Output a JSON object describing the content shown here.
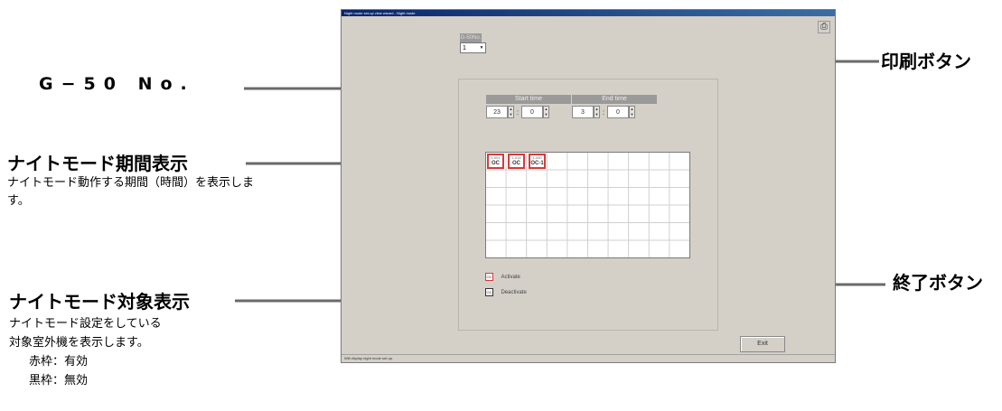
{
  "window": {
    "title": "Night mode set-up view wizard - Night mode",
    "status": "Will display night mode set-up."
  },
  "g50": {
    "label": "G-50No.",
    "value": "1"
  },
  "time": {
    "start_label": "Start time",
    "start_hour": "23",
    "start_min": "0",
    "end_label": "End time",
    "end_hour": "3",
    "end_min": "0",
    "colon": ":"
  },
  "grid": {
    "units": [
      {
        "num": "1-001",
        "code": "OC"
      },
      {
        "num": "1-015",
        "code": "OC"
      },
      {
        "num": "1-030",
        "code": "OC-1"
      }
    ]
  },
  "legend": {
    "icon_text": "OC",
    "activate": "Activate",
    "deactivate": "Deactivate"
  },
  "buttons": {
    "exit": "Exit",
    "print_icon": "printer-icon"
  },
  "annotations": {
    "g50": "G−50 No.",
    "night_period_title": "ナイトモード期間表示",
    "night_period_desc": "ナイトモード動作する期間（時間）を表示します。",
    "target_title": "ナイトモード対象表示",
    "target_desc_1": "ナイトモード設定をしている",
    "target_desc_2": "対象室外機を表示します。",
    "red_frame": "赤枠：有効",
    "black_frame": "黒枠：無効",
    "print_button": "印刷ボタン",
    "exit_button": "終了ボタン"
  },
  "colors": {
    "active_frame": "#d63a3a",
    "inactive_frame": "#333333",
    "window_bg": "#d4d0c8"
  }
}
